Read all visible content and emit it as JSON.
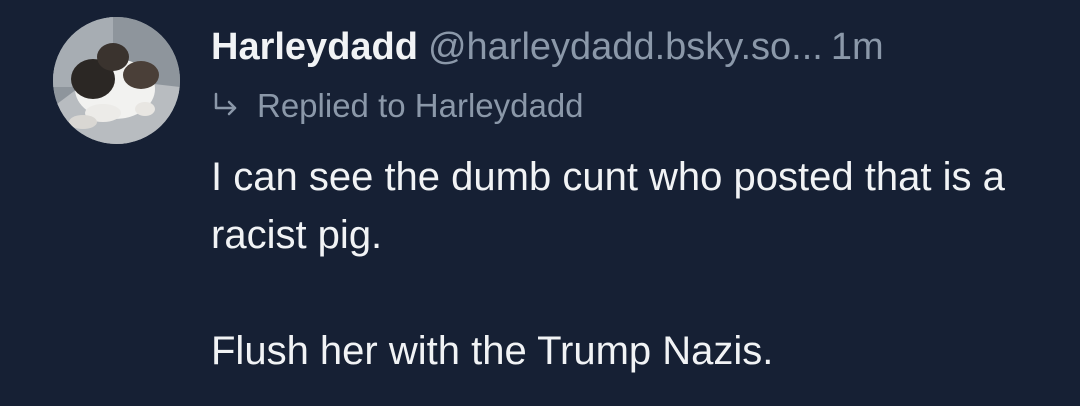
{
  "post": {
    "author": {
      "display_name": "Harleydadd",
      "handle": "@harleydadd.bsky.so...",
      "avatar_icon": "cat-avatar-icon"
    },
    "timestamp": "1m",
    "reply_context": {
      "icon": "reply-arrow-icon",
      "text": "Replied to Harleydadd"
    },
    "body": {
      "line1": "I can see the dumb cunt who posted that is a racist pig.",
      "line2": "Flush her with the Trump Nazis."
    }
  },
  "colors": {
    "background": "#162034",
    "primary_text": "#f1f3f5",
    "secondary_text": "#8b98a9"
  }
}
